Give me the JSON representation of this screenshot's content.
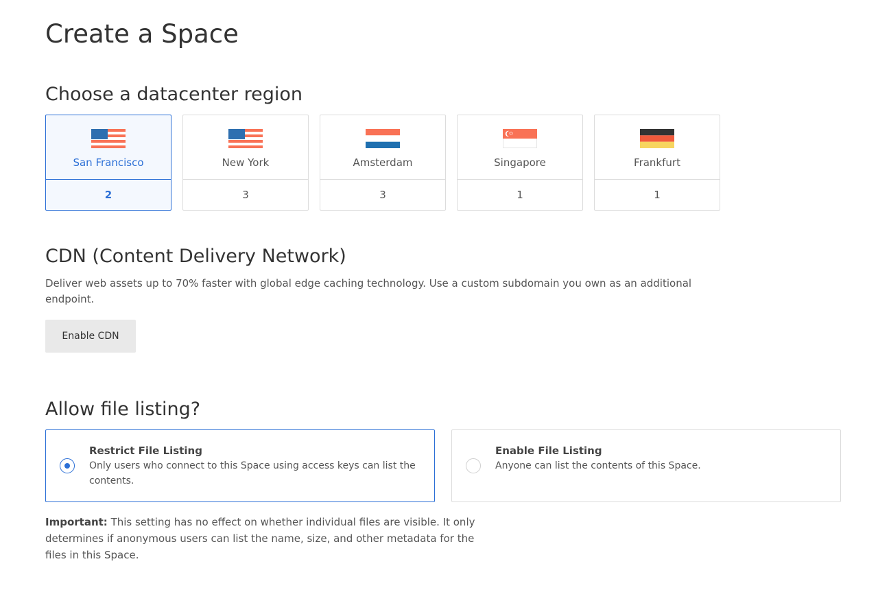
{
  "page": {
    "title": "Create a Space"
  },
  "region_section": {
    "title": "Choose a datacenter region",
    "regions": [
      {
        "name": "San Francisco",
        "count": "2",
        "flag": "us-flag-icon",
        "selected": true
      },
      {
        "name": "New York",
        "count": "3",
        "flag": "us-flag-icon",
        "selected": false
      },
      {
        "name": "Amsterdam",
        "count": "3",
        "flag": "nl-flag-icon",
        "selected": false
      },
      {
        "name": "Singapore",
        "count": "1",
        "flag": "sg-flag-icon",
        "selected": false
      },
      {
        "name": "Frankfurt",
        "count": "1",
        "flag": "de-flag-icon",
        "selected": false
      }
    ]
  },
  "cdn_section": {
    "title": "CDN (Content Delivery Network)",
    "description": "Deliver web assets up to 70% faster with global edge caching technology. Use a custom subdomain you own as an additional endpoint.",
    "button_label": "Enable CDN"
  },
  "listing_section": {
    "title": "Allow file listing?",
    "options": [
      {
        "title": "Restrict File Listing",
        "description": "Only users who connect to this Space using access keys can list the contents.",
        "selected": true
      },
      {
        "title": "Enable File Listing",
        "description": "Anyone can list the contents of this Space.",
        "selected": false
      }
    ],
    "important_label": "Important:",
    "important_text": " This setting has no effect on whether individual files are visible. It only determines if anonymous users can list the name, size, and other metadata for the files in this Space."
  },
  "colors": {
    "accent": "#2b6fd6",
    "us_blue": "#2e6fb0",
    "us_red": "#f97256",
    "nl_red": "#f97256",
    "nl_blue": "#1f70b0",
    "sg_red": "#f97256",
    "de_black": "#333333",
    "de_red": "#f05a3c",
    "de_gold": "#f7d560"
  }
}
